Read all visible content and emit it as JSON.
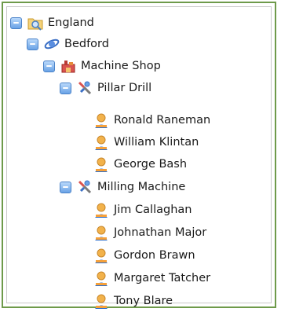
{
  "tree": {
    "root": {
      "label": "England",
      "icon": "folder-search-icon",
      "children": [
        {
          "label": "Bedford",
          "icon": "earth-satellite-icon",
          "children": [
            {
              "label": "Machine Shop",
              "icon": "workshop-icon",
              "children": [
                {
                  "label": "Pillar Drill",
                  "icon": "tools-icon",
                  "children": [
                    {
                      "label": "Ronald Raneman",
                      "icon": "person-icon"
                    },
                    {
                      "label": "William Klintan",
                      "icon": "person-icon"
                    },
                    {
                      "label": "George Bash",
                      "icon": "person-icon"
                    }
                  ]
                },
                {
                  "label": "Milling Machine",
                  "icon": "tools-icon",
                  "children": [
                    {
                      "label": "Jim Callaghan",
                      "icon": "person-icon"
                    },
                    {
                      "label": "Johnathan Major",
                      "icon": "person-icon"
                    },
                    {
                      "label": "Gordon Brawn",
                      "icon": "person-icon"
                    },
                    {
                      "label": "Margaret Tatcher",
                      "icon": "person-icon"
                    },
                    {
                      "label": "Tony Blare",
                      "icon": "person-icon"
                    }
                  ]
                }
              ]
            }
          ]
        }
      ]
    }
  },
  "colors": {
    "frame_border": "#6e9a4a",
    "toggle_fill": "#6aa3e6",
    "person_head": "#f2b24b",
    "person_body": "#2a6fd0"
  }
}
